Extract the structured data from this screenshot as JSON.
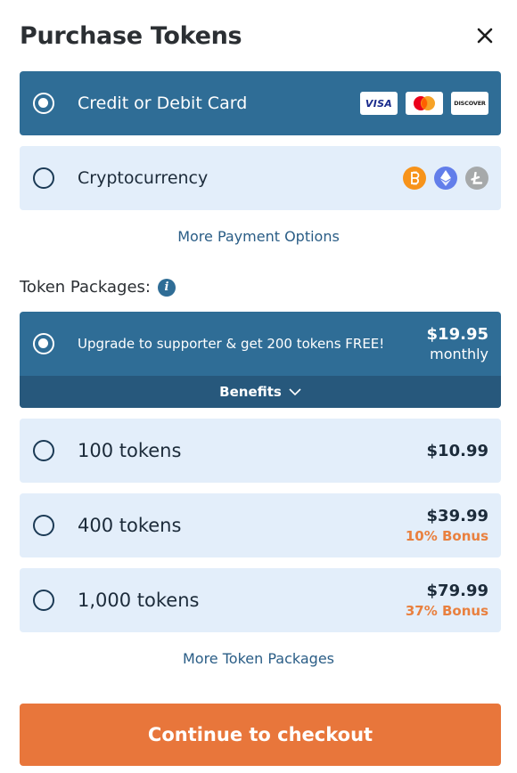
{
  "header": {
    "title": "Purchase Tokens",
    "close_icon": "close-icon"
  },
  "payment_methods": [
    {
      "label": "Credit or Debit Card",
      "selected": true,
      "logos": [
        "VISA",
        "DISCOVER"
      ]
    },
    {
      "label": "Cryptocurrency",
      "selected": false,
      "coins": [
        "bitcoin-icon",
        "ethereum-icon",
        "litecoin-icon"
      ]
    }
  ],
  "more_payment_options": "More Payment Options",
  "token_packages": {
    "label": "Token Packages:",
    "supporter": {
      "label": "Upgrade to supporter & get 200 tokens FREE!",
      "price": "$19.95",
      "period": "monthly",
      "benefits": "Benefits",
      "selected": true
    },
    "items": [
      {
        "label": "100 tokens",
        "price": "$10.99",
        "bonus": ""
      },
      {
        "label": "400 tokens",
        "price": "$39.99",
        "bonus": "10% Bonus"
      },
      {
        "label": "1,000 tokens",
        "price": "$79.99",
        "bonus": "37% Bonus"
      }
    ]
  },
  "more_token_packages": "More Token Packages",
  "checkout_button": "Continue to checkout",
  "colors": {
    "primary": "#2f6d96",
    "light": "#e3eefa",
    "accent": "#e8763b"
  }
}
